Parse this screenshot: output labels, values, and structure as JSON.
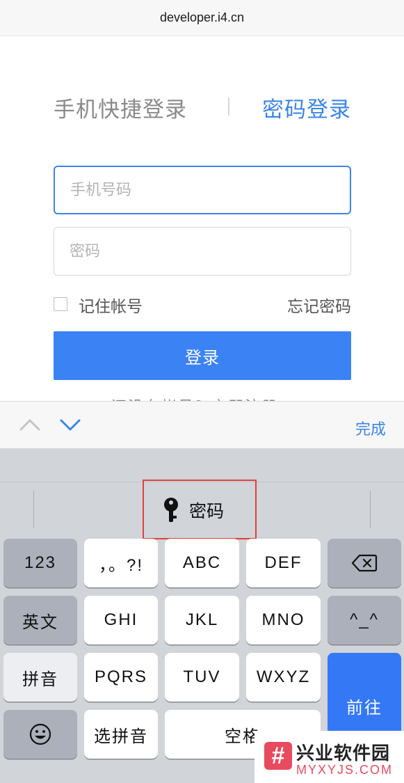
{
  "browser": {
    "url": "developer.i4.cn"
  },
  "login": {
    "tab_quick": "手机快捷登录",
    "tab_password": "密码登录",
    "phone_placeholder": "手机号码",
    "password_placeholder": "密码",
    "remember_label": "记住帐号",
    "forgot_label": "忘记密码",
    "submit_label": "登录",
    "partial_text": "还没有帐号？立即注册"
  },
  "toolbar": {
    "done_label": "完成",
    "prev_icon": "chevron-up-icon",
    "next_icon": "chevron-down-icon"
  },
  "suggestion": {
    "label": "密码",
    "icon": "key-icon"
  },
  "keys": {
    "num": "123",
    "punct": "，。?!",
    "abc": "ABC",
    "def": "DEF",
    "delete_icon": "backspace-icon",
    "english": "英文",
    "ghi": "GHI",
    "jkl": "JKL",
    "mno": "MNO",
    "emoticon": "^_^",
    "pinyin": "拼音",
    "pqrs": "PQRS",
    "tuv": "TUV",
    "wxyz": "WXYZ",
    "go": "前往",
    "emoji_icon": "smiley-icon",
    "select_pinyin": "选拼音",
    "space": "空格"
  },
  "watermark": {
    "mark": "#",
    "title": "兴业软件园",
    "subtitle": "MYXYJS.COM"
  },
  "colors": {
    "accent": "#3b85e6",
    "button": "#3b82f4",
    "highlight_box": "#e0403c"
  }
}
